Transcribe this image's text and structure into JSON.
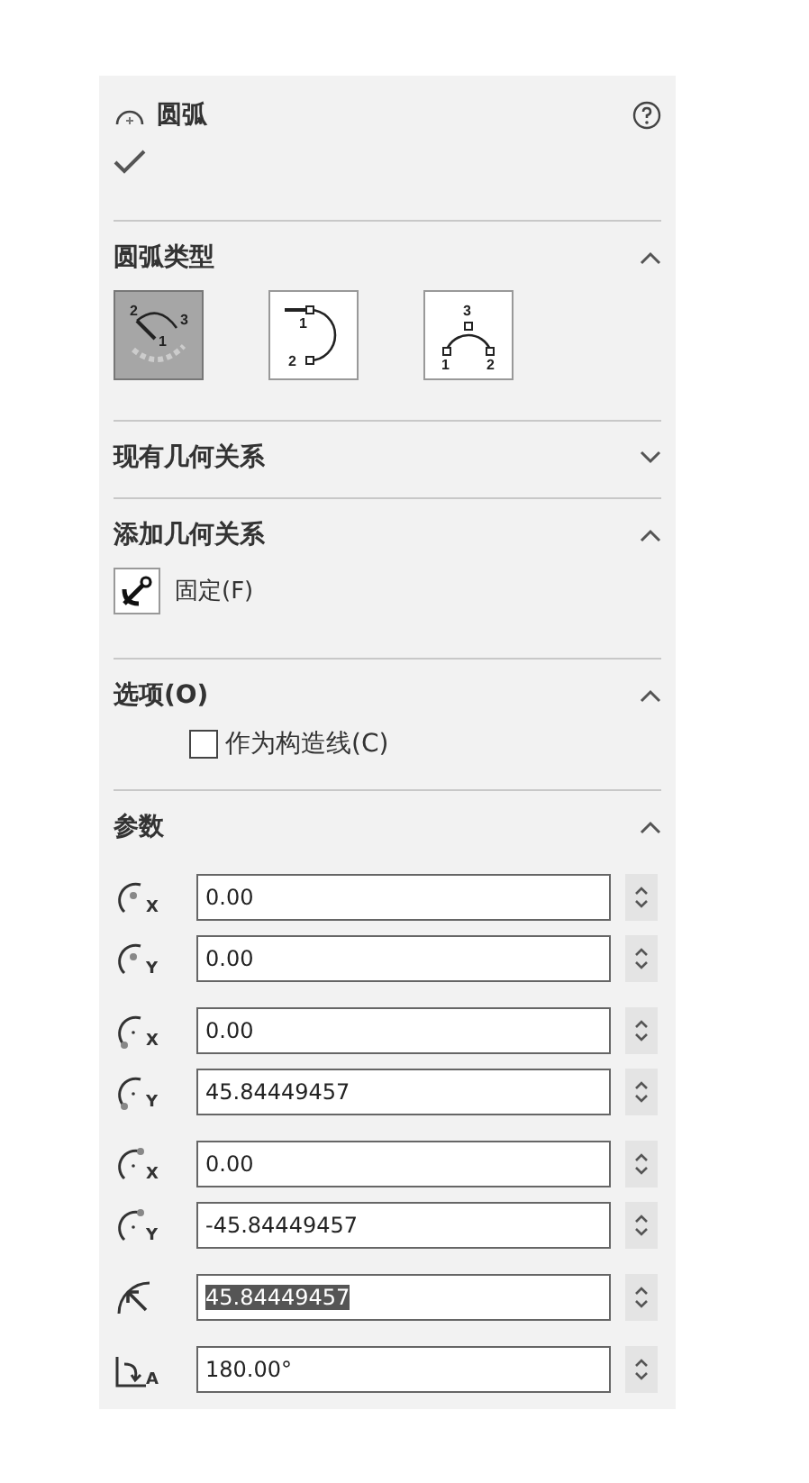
{
  "header": {
    "title": "圆弧"
  },
  "sections": [
    {
      "kind": "arc_type",
      "title": "圆弧类型",
      "expanded": true,
      "options": [
        {
          "selected": true,
          "points": [
            "2",
            "1",
            "3"
          ]
        },
        {
          "selected": false,
          "points": [
            "1",
            "2"
          ]
        },
        {
          "selected": false,
          "points": [
            "3",
            "1",
            "2"
          ]
        }
      ]
    },
    {
      "title": "现有几何关系",
      "expanded": false
    },
    {
      "kind": "relations",
      "title": "添加几何关系",
      "expanded": true,
      "items": [
        {
          "label": "固定(F)"
        }
      ]
    },
    {
      "kind": "options",
      "title": "选项(O)",
      "expanded": true,
      "checkboxes": [
        {
          "label": "作为构造线(C)",
          "checked": false
        }
      ]
    },
    {
      "kind": "parameters",
      "title": "参数",
      "expanded": true,
      "groups": [
        [
          {
            "kind": "center",
            "axis": "X",
            "value": "0.00",
            "highlighted": false
          },
          {
            "kind": "center",
            "axis": "Y",
            "value": "0.00",
            "highlighted": false
          }
        ],
        [
          {
            "kind": "start",
            "axis": "X",
            "value": "0.00",
            "highlighted": false
          },
          {
            "kind": "start",
            "axis": "Y",
            "value": "45.84449457",
            "highlighted": false
          }
        ],
        [
          {
            "kind": "end",
            "axis": "X",
            "value": "0.00",
            "highlighted": false
          },
          {
            "kind": "end",
            "axis": "Y",
            "value": "-45.84449457",
            "highlighted": false
          }
        ],
        [
          {
            "kind": "radius",
            "value": "45.84449457",
            "highlighted": true
          }
        ],
        [
          {
            "kind": "angle",
            "axis": "A",
            "value": "180.00°",
            "highlighted": false
          }
        ]
      ]
    }
  ]
}
